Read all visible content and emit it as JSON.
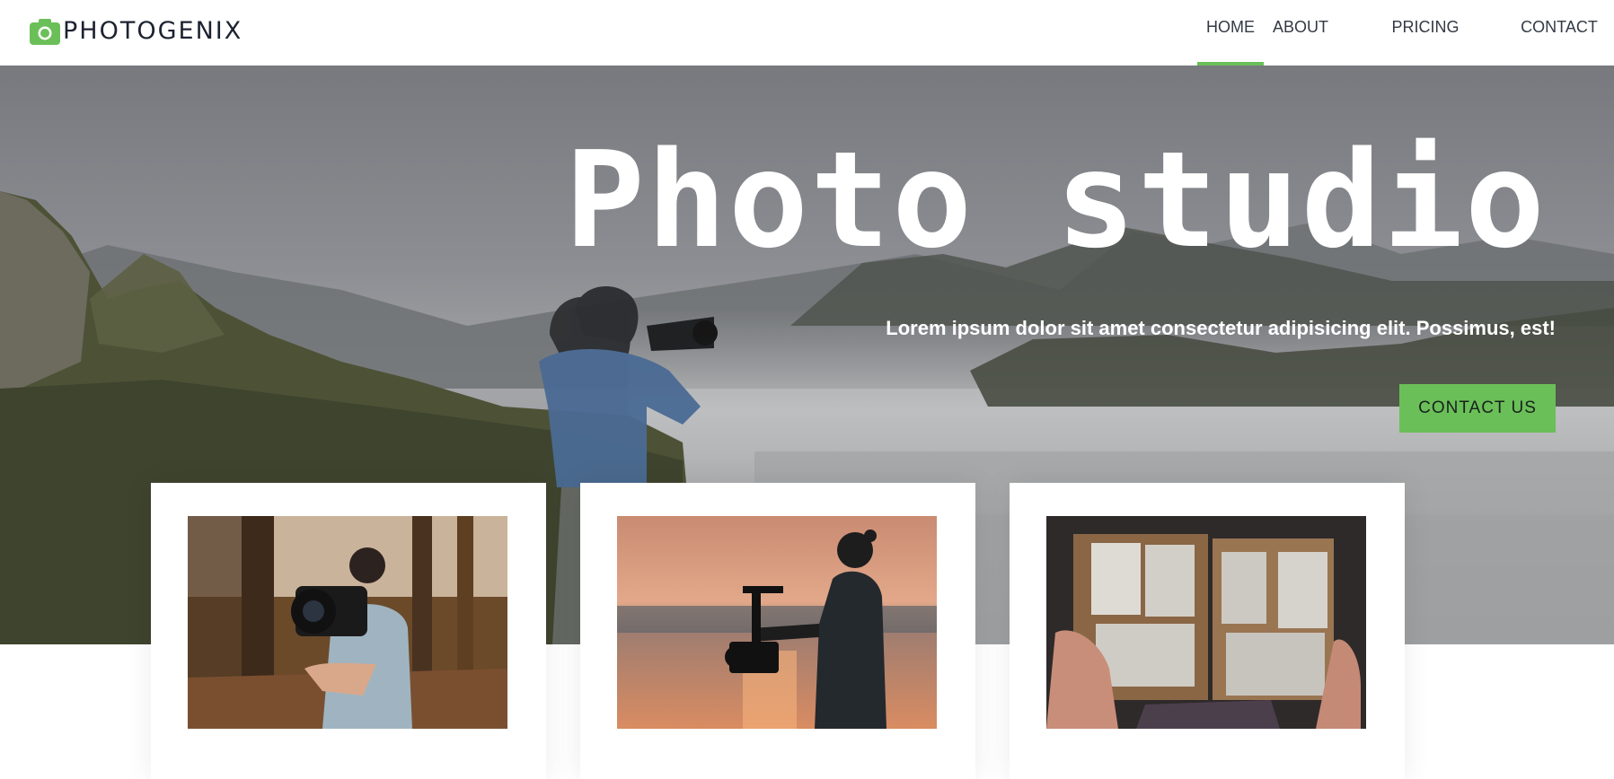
{
  "header": {
    "brand": "PHOTOGENIX",
    "brand_icon": "camera-icon",
    "nav": [
      {
        "label": "HOME",
        "active": true
      },
      {
        "label": "ABOUT",
        "active": false
      },
      {
        "label": "PRICING",
        "active": false
      },
      {
        "label": "CONTACT",
        "active": false
      }
    ]
  },
  "hero": {
    "title": "Photo studio",
    "subtitle": "Lorem ipsum dolor sit amet consectetur adipisicing elit. Possimus, est!",
    "cta_label": "CONTACT US"
  },
  "cards": [
    {
      "image": "photographer-in-forest-photo"
    },
    {
      "image": "videographer-at-sunset-photo"
    },
    {
      "image": "photo-album-photo"
    }
  ],
  "colors": {
    "accent": "#6bbf59",
    "text_dark": "#1c2230",
    "white": "#ffffff"
  }
}
